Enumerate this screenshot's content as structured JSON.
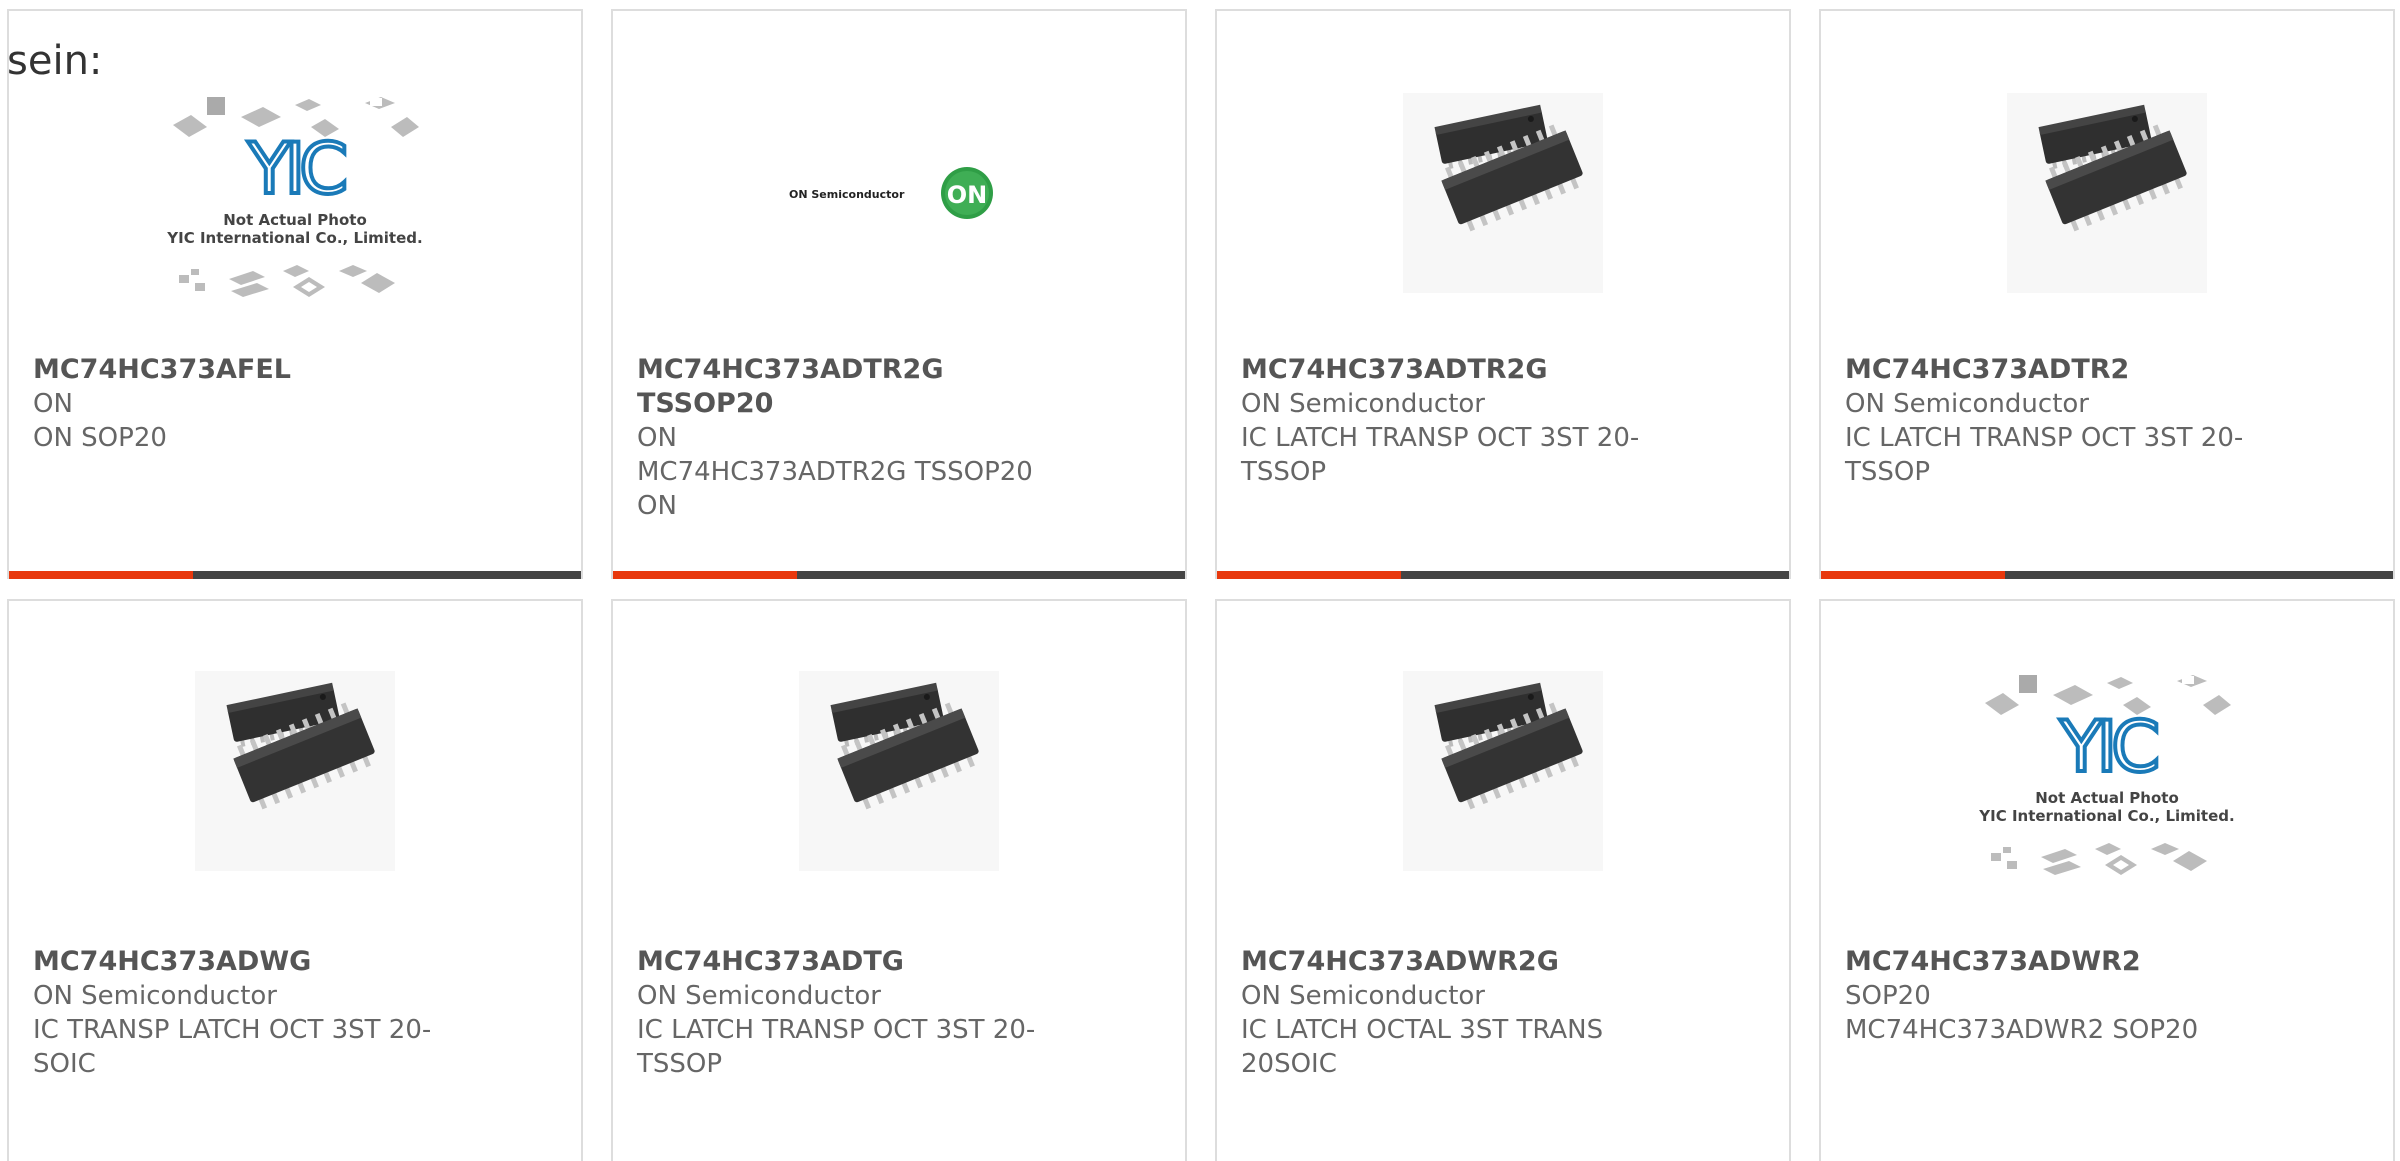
{
  "intro_text": "sein:",
  "colors": {
    "accent": "#e8380d",
    "bar": "#444444",
    "border": "#dddddd"
  },
  "yic_placeholder": {
    "line1": "Not Actual Photo",
    "line2": "YIC International Co., Limited.",
    "logo": "YIC"
  },
  "on_logo": {
    "wordmark": "ON Semiconductor",
    "badge": "ON"
  },
  "products": [
    {
      "name": "MC74HC373AFEL",
      "line1": "ON",
      "line2": "ON SOP20",
      "line3": "",
      "image": "yic-placeholder"
    },
    {
      "name": "MC74HC373ADTR2G TSSOP20",
      "line1": "ON",
      "line2": "MC74HC373ADTR2G TSSOP20",
      "line3": "ON",
      "image": "on-logo"
    },
    {
      "name": "MC74HC373ADTR2G",
      "line1": "ON Semiconductor",
      "line2": "IC LATCH TRANSP OCT 3ST 20-",
      "line3": "TSSOP",
      "image": "ic-chip-photo"
    },
    {
      "name": "MC74HC373ADTR2",
      "line1": "ON Semiconductor",
      "line2": "IC LATCH TRANSP OCT 3ST 20-",
      "line3": "TSSOP",
      "image": "ic-chip-photo"
    },
    {
      "name": "MC74HC373ADWG",
      "line1": "ON Semiconductor",
      "line2": "IC TRANSP LATCH OCT 3ST 20-",
      "line3": "SOIC",
      "image": "ic-chip-photo"
    },
    {
      "name": "MC74HC373ADTG",
      "line1": "ON Semiconductor",
      "line2": "IC LATCH TRANSP OCT 3ST 20-",
      "line3": "TSSOP",
      "image": "ic-chip-photo"
    },
    {
      "name": "MC74HC373ADWR2G",
      "line1": "ON Semiconductor",
      "line2": "IC LATCH OCTAL 3ST TRANS",
      "line3": "20SOIC",
      "image": "ic-chip-photo"
    },
    {
      "name": "MC74HC373ADWR2",
      "line1": "SOP20",
      "line2": "MC74HC373ADWR2 SOP20",
      "line3": "",
      "image": "yic-placeholder"
    }
  ]
}
